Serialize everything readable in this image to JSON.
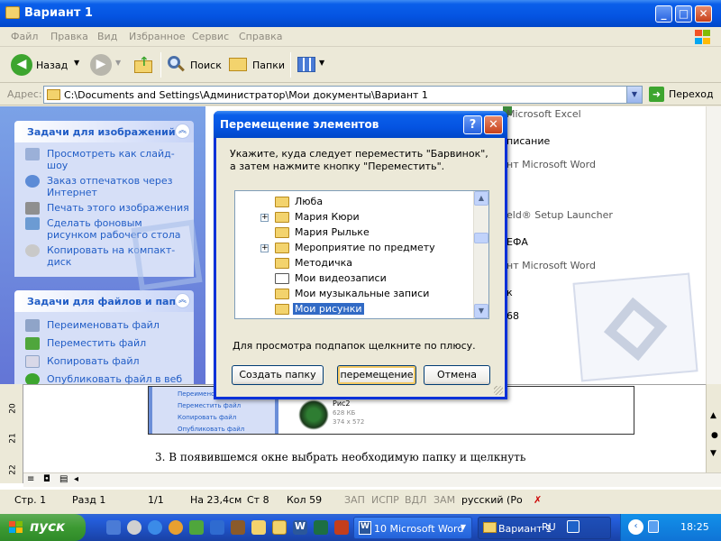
{
  "window": {
    "title": "Вариант 1"
  },
  "menu": {
    "items": [
      "Файл",
      "Правка",
      "Вид",
      "Избранное",
      "Сервис",
      "Справка"
    ]
  },
  "toolbar": {
    "back_label": "Назад",
    "search_label": "Поиск",
    "folders_label": "Папки"
  },
  "address": {
    "label": "Адрес:",
    "value": "C:\\Documents and Settings\\Администратор\\Мои документы\\Вариант 1",
    "go_label": "Переход"
  },
  "taskpane": {
    "image_tasks": {
      "title": "Задачи для изображений",
      "items": [
        "Просмотреть как слайд-шоу",
        "Заказ отпечатков через Интернет",
        "Печать этого изображения",
        "Сделать фоновым рисунком рабочего стола",
        "Копировать на компакт-диск"
      ]
    },
    "file_tasks": {
      "title": "Задачи для файлов и папок",
      "items": [
        "Переименовать файл",
        "Переместить файл",
        "Копировать файл",
        "Опубликовать файл в веб"
      ]
    }
  },
  "files": {
    "lines": [
      "Microsoft Excel",
      "писание",
      "нт Microsoft Word",
      "eld® Setup Launcher",
      "ЕФА",
      "нт Microsoft Word",
      "к",
      "68"
    ]
  },
  "dialog": {
    "title": "Перемещение элементов",
    "message": "Укажите, куда следует переместить \"Барвинок\", а затем нажмите кнопку \"Переместить\".",
    "tree": [
      {
        "label": "Люба",
        "expandable": false,
        "selected": false
      },
      {
        "label": "Мария Кюри",
        "expandable": true,
        "selected": false
      },
      {
        "label": "Мария Рыльке",
        "expandable": false,
        "selected": false
      },
      {
        "label": "Мероприятие по предмету",
        "expandable": true,
        "selected": false
      },
      {
        "label": "Методичка",
        "expandable": false,
        "selected": false
      },
      {
        "label": "Мои видеозаписи",
        "expandable": false,
        "selected": false
      },
      {
        "label": "Мои музыкальные записи",
        "expandable": false,
        "selected": false
      },
      {
        "label": "Мои рисунки",
        "expandable": false,
        "selected": true
      }
    ],
    "hint": "Для просмотра подпапок щелкните по плюсу.",
    "create_folder": "Создать папку",
    "move": "перемещение",
    "cancel": "Отмена"
  },
  "document": {
    "ruler_marks": [
      "22",
      "21",
      "20"
    ],
    "thumb_tasks": [
      "Переимено",
      "Переместить файл",
      "Копировать файл",
      "Опубликовать файл"
    ],
    "thumb_file": {
      "name": "Рис2",
      "size": "628 КБ",
      "dims": "374 x 572"
    },
    "text": "3.   В появившемся окне выбрать необходимую папку и щелкнуть"
  },
  "status": {
    "page": "Стр.  1",
    "section": "Разд  1",
    "count": "1/1",
    "position": "На 23,4см",
    "line": "Ст  8",
    "column": "Кол  59",
    "modes": [
      "ЗАП",
      "ИСПР",
      "ВДЛ",
      "ЗАМ"
    ],
    "language": "русский (Ро"
  },
  "taskbar": {
    "start": "пуск",
    "buttons": [
      "10 Microsoft Word",
      "Вариант 1"
    ],
    "lang": "RU",
    "time": "18:25"
  },
  "colors": {
    "xp_blue": "#0A5FEA",
    "task_link": "#215DC6",
    "selection": "#316AC5",
    "start_green": "#3C9A32"
  }
}
